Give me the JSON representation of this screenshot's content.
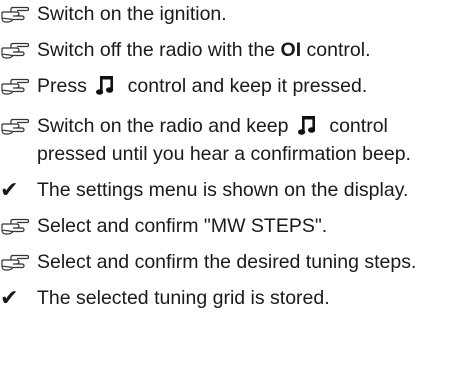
{
  "steps": [
    {
      "type": "action",
      "icon": "pointing-hand-icon",
      "parts": [
        "Switch on the ignition."
      ]
    },
    {
      "type": "action",
      "icon": "pointing-hand-icon",
      "parts": [
        "Switch off the radio with the ",
        "OI",
        " control."
      ]
    },
    {
      "type": "action",
      "icon": "pointing-hand-icon",
      "parts": [
        "Press ",
        " control and keep it pressed."
      ],
      "inline_icon": "music-note-icon"
    },
    {
      "type": "action",
      "icon": "pointing-hand-icon",
      "parts": [
        "Switch on the radio and keep ",
        " control pressed until you hear a confirmation beep."
      ],
      "inline_icon": "music-note-icon"
    },
    {
      "type": "result",
      "icon": "checkmark-icon",
      "parts": [
        "The settings menu is shown on the display."
      ]
    },
    {
      "type": "action",
      "icon": "pointing-hand-icon",
      "parts": [
        "Select and confirm \"MW STEPS\"."
      ]
    },
    {
      "type": "action",
      "icon": "pointing-hand-icon",
      "parts": [
        "Select and confirm the desired tuning steps."
      ]
    },
    {
      "type": "result",
      "icon": "checkmark-icon",
      "parts": [
        "The selected tuning grid is stored."
      ]
    }
  ],
  "check_glyph": "✔"
}
